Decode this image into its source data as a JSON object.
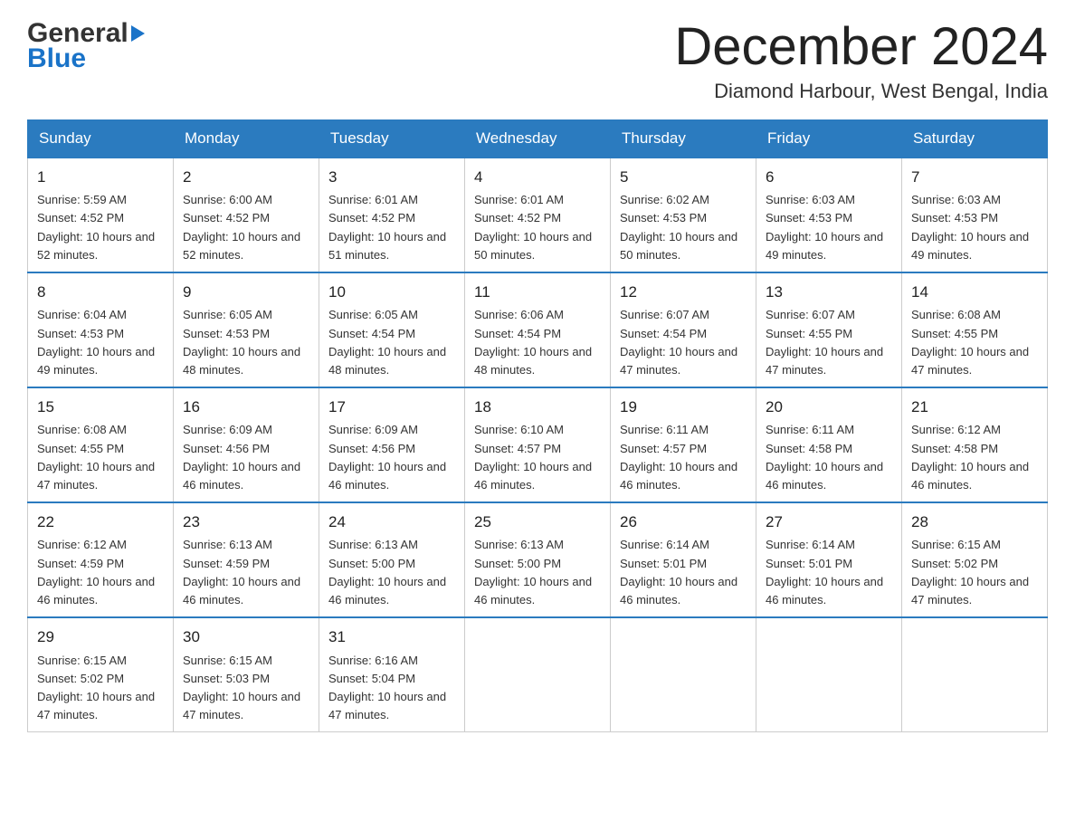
{
  "logo": {
    "word1": "General",
    "word2": "Blue"
  },
  "header": {
    "month_year": "December 2024",
    "location": "Diamond Harbour, West Bengal, India"
  },
  "weekdays": [
    "Sunday",
    "Monday",
    "Tuesday",
    "Wednesday",
    "Thursday",
    "Friday",
    "Saturday"
  ],
  "weeks": [
    [
      {
        "day": "1",
        "sunrise": "Sunrise: 5:59 AM",
        "sunset": "Sunset: 4:52 PM",
        "daylight": "Daylight: 10 hours and 52 minutes."
      },
      {
        "day": "2",
        "sunrise": "Sunrise: 6:00 AM",
        "sunset": "Sunset: 4:52 PM",
        "daylight": "Daylight: 10 hours and 52 minutes."
      },
      {
        "day": "3",
        "sunrise": "Sunrise: 6:01 AM",
        "sunset": "Sunset: 4:52 PM",
        "daylight": "Daylight: 10 hours and 51 minutes."
      },
      {
        "day": "4",
        "sunrise": "Sunrise: 6:01 AM",
        "sunset": "Sunset: 4:52 PM",
        "daylight": "Daylight: 10 hours and 50 minutes."
      },
      {
        "day": "5",
        "sunrise": "Sunrise: 6:02 AM",
        "sunset": "Sunset: 4:53 PM",
        "daylight": "Daylight: 10 hours and 50 minutes."
      },
      {
        "day": "6",
        "sunrise": "Sunrise: 6:03 AM",
        "sunset": "Sunset: 4:53 PM",
        "daylight": "Daylight: 10 hours and 49 minutes."
      },
      {
        "day": "7",
        "sunrise": "Sunrise: 6:03 AM",
        "sunset": "Sunset: 4:53 PM",
        "daylight": "Daylight: 10 hours and 49 minutes."
      }
    ],
    [
      {
        "day": "8",
        "sunrise": "Sunrise: 6:04 AM",
        "sunset": "Sunset: 4:53 PM",
        "daylight": "Daylight: 10 hours and 49 minutes."
      },
      {
        "day": "9",
        "sunrise": "Sunrise: 6:05 AM",
        "sunset": "Sunset: 4:53 PM",
        "daylight": "Daylight: 10 hours and 48 minutes."
      },
      {
        "day": "10",
        "sunrise": "Sunrise: 6:05 AM",
        "sunset": "Sunset: 4:54 PM",
        "daylight": "Daylight: 10 hours and 48 minutes."
      },
      {
        "day": "11",
        "sunrise": "Sunrise: 6:06 AM",
        "sunset": "Sunset: 4:54 PM",
        "daylight": "Daylight: 10 hours and 48 minutes."
      },
      {
        "day": "12",
        "sunrise": "Sunrise: 6:07 AM",
        "sunset": "Sunset: 4:54 PM",
        "daylight": "Daylight: 10 hours and 47 minutes."
      },
      {
        "day": "13",
        "sunrise": "Sunrise: 6:07 AM",
        "sunset": "Sunset: 4:55 PM",
        "daylight": "Daylight: 10 hours and 47 minutes."
      },
      {
        "day": "14",
        "sunrise": "Sunrise: 6:08 AM",
        "sunset": "Sunset: 4:55 PM",
        "daylight": "Daylight: 10 hours and 47 minutes."
      }
    ],
    [
      {
        "day": "15",
        "sunrise": "Sunrise: 6:08 AM",
        "sunset": "Sunset: 4:55 PM",
        "daylight": "Daylight: 10 hours and 47 minutes."
      },
      {
        "day": "16",
        "sunrise": "Sunrise: 6:09 AM",
        "sunset": "Sunset: 4:56 PM",
        "daylight": "Daylight: 10 hours and 46 minutes."
      },
      {
        "day": "17",
        "sunrise": "Sunrise: 6:09 AM",
        "sunset": "Sunset: 4:56 PM",
        "daylight": "Daylight: 10 hours and 46 minutes."
      },
      {
        "day": "18",
        "sunrise": "Sunrise: 6:10 AM",
        "sunset": "Sunset: 4:57 PM",
        "daylight": "Daylight: 10 hours and 46 minutes."
      },
      {
        "day": "19",
        "sunrise": "Sunrise: 6:11 AM",
        "sunset": "Sunset: 4:57 PM",
        "daylight": "Daylight: 10 hours and 46 minutes."
      },
      {
        "day": "20",
        "sunrise": "Sunrise: 6:11 AM",
        "sunset": "Sunset: 4:58 PM",
        "daylight": "Daylight: 10 hours and 46 minutes."
      },
      {
        "day": "21",
        "sunrise": "Sunrise: 6:12 AM",
        "sunset": "Sunset: 4:58 PM",
        "daylight": "Daylight: 10 hours and 46 minutes."
      }
    ],
    [
      {
        "day": "22",
        "sunrise": "Sunrise: 6:12 AM",
        "sunset": "Sunset: 4:59 PM",
        "daylight": "Daylight: 10 hours and 46 minutes."
      },
      {
        "day": "23",
        "sunrise": "Sunrise: 6:13 AM",
        "sunset": "Sunset: 4:59 PM",
        "daylight": "Daylight: 10 hours and 46 minutes."
      },
      {
        "day": "24",
        "sunrise": "Sunrise: 6:13 AM",
        "sunset": "Sunset: 5:00 PM",
        "daylight": "Daylight: 10 hours and 46 minutes."
      },
      {
        "day": "25",
        "sunrise": "Sunrise: 6:13 AM",
        "sunset": "Sunset: 5:00 PM",
        "daylight": "Daylight: 10 hours and 46 minutes."
      },
      {
        "day": "26",
        "sunrise": "Sunrise: 6:14 AM",
        "sunset": "Sunset: 5:01 PM",
        "daylight": "Daylight: 10 hours and 46 minutes."
      },
      {
        "day": "27",
        "sunrise": "Sunrise: 6:14 AM",
        "sunset": "Sunset: 5:01 PM",
        "daylight": "Daylight: 10 hours and 46 minutes."
      },
      {
        "day": "28",
        "sunrise": "Sunrise: 6:15 AM",
        "sunset": "Sunset: 5:02 PM",
        "daylight": "Daylight: 10 hours and 47 minutes."
      }
    ],
    [
      {
        "day": "29",
        "sunrise": "Sunrise: 6:15 AM",
        "sunset": "Sunset: 5:02 PM",
        "daylight": "Daylight: 10 hours and 47 minutes."
      },
      {
        "day": "30",
        "sunrise": "Sunrise: 6:15 AM",
        "sunset": "Sunset: 5:03 PM",
        "daylight": "Daylight: 10 hours and 47 minutes."
      },
      {
        "day": "31",
        "sunrise": "Sunrise: 6:16 AM",
        "sunset": "Sunset: 5:04 PM",
        "daylight": "Daylight: 10 hours and 47 minutes."
      },
      null,
      null,
      null,
      null
    ]
  ]
}
